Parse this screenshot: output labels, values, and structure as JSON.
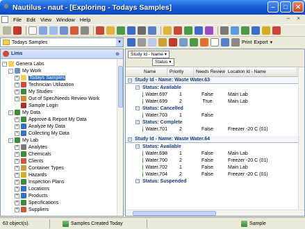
{
  "window": {
    "title": "Nautilus - naut - [Exploring - Todays Samples]"
  },
  "menu": [
    "File",
    "Edit",
    "View",
    "Window",
    "Help"
  ],
  "address": {
    "value": "Todays Samples"
  },
  "left_panel": {
    "title": "Lims",
    "tree": [
      {
        "label": "Genera Labs",
        "icon": "folder-icon",
        "color": "#f3cf5a",
        "depth": 0,
        "expander": "-"
      },
      {
        "label": "My Work",
        "icon": "work-icon",
        "color": "#6a8fc9",
        "depth": 1,
        "expander": "-"
      },
      {
        "label": "Todays Samples",
        "icon": "samples-icon",
        "color": "#f3cf5a",
        "depth": 2,
        "expander": "+",
        "selected": true
      },
      {
        "label": "Technician Utilization",
        "icon": "chart-icon",
        "color": "#d04a3a",
        "depth": 2,
        "expander": "+"
      },
      {
        "label": "My Studies",
        "icon": "study-icon",
        "color": "#3a8c3a",
        "depth": 2,
        "expander": "+"
      },
      {
        "label": "Out of Spec/Needs Review Work",
        "icon": "warning-icon",
        "color": "#d08a2a",
        "depth": 2,
        "expander": "+"
      },
      {
        "label": "Sample Login",
        "icon": "login-icon",
        "color": "#b03030",
        "depth": 2,
        "expander": ""
      },
      {
        "label": "My Data",
        "icon": "data-icon",
        "color": "#3a8c3a",
        "depth": 1,
        "expander": "-"
      },
      {
        "label": "Approve & Report My Data",
        "icon": "approve-icon",
        "color": "#3a8c3a",
        "depth": 2,
        "expander": "+"
      },
      {
        "label": "Analyze My Data",
        "icon": "analyze-icon",
        "color": "#3a6cc9",
        "depth": 2,
        "expander": "+"
      },
      {
        "label": "Collecting My Data",
        "icon": "collect-icon",
        "color": "#3a6cc9",
        "depth": 2,
        "expander": "+"
      },
      {
        "label": "My Lab",
        "icon": "lab-icon",
        "color": "#3a8c3a",
        "depth": 1,
        "expander": "-"
      },
      {
        "label": "Analytes",
        "icon": "analytes-icon",
        "color": "#7a7a7a",
        "depth": 2,
        "expander": "+"
      },
      {
        "label": "Chemicals",
        "icon": "chemicals-icon",
        "color": "#3a8c3a",
        "depth": 2,
        "expander": "+"
      },
      {
        "label": "Clients",
        "icon": "clients-icon",
        "color": "#c95a3a",
        "depth": 2,
        "expander": "+"
      },
      {
        "label": "Container Types",
        "icon": "container-icon",
        "color": "#c9a03a",
        "depth": 2,
        "expander": "+"
      },
      {
        "label": "Hazards",
        "icon": "hazard-icon",
        "color": "#d0b020",
        "depth": 2,
        "expander": "+"
      },
      {
        "label": "Inspection Plans",
        "icon": "inspection-icon",
        "color": "#3a8c3a",
        "depth": 2,
        "expander": "+"
      },
      {
        "label": "Locations",
        "icon": "location-icon",
        "color": "#3a6cc9",
        "depth": 2,
        "expander": "+"
      },
      {
        "label": "Products",
        "icon": "products-icon",
        "color": "#3a6cc9",
        "depth": 2,
        "expander": "+"
      },
      {
        "label": "Specifications",
        "icon": "spec-icon",
        "color": "#3a8c3a",
        "depth": 2,
        "expander": "+"
      },
      {
        "label": "Suppliers",
        "icon": "suppliers-icon",
        "color": "#c95a3a",
        "depth": 2,
        "expander": "+"
      }
    ]
  },
  "right_panel": {
    "toolbar": {
      "print_label": "Print",
      "export_label": "Export"
    },
    "group_chips": {
      "study": "Study Id - Name",
      "status": "Status"
    },
    "columns": [
      "Name",
      "Priority",
      "Needs Review",
      "Location Id - Name"
    ],
    "groups": [
      {
        "label": "Study Id - Name: Waste Water.63",
        "statuses": [
          {
            "label": "Status: Available",
            "rows": [
              {
                "name": "Water.697",
                "priority": "1",
                "needs_review": "False",
                "location": "Main Lab"
              },
              {
                "name": "Water.699",
                "priority": "2",
                "needs_review": "True",
                "location": "Main Lab"
              }
            ]
          },
          {
            "label": "Status: Cancelled",
            "rows": [
              {
                "name": "Water.703",
                "priority": "1",
                "needs_review": "False",
                "location": ""
              }
            ]
          },
          {
            "label": "Status: Complete",
            "rows": [
              {
                "name": "Water.701",
                "priority": "2",
                "needs_review": "False",
                "location": "Freezer -20 C (01)"
              }
            ]
          }
        ]
      },
      {
        "label": "Study Id - Name: Waste Water.64",
        "statuses": [
          {
            "label": "Status: Available",
            "rows": [
              {
                "name": "Water.698",
                "priority": "1",
                "needs_review": "False",
                "location": "Main Lab"
              },
              {
                "name": "Water.700",
                "priority": "2",
                "needs_review": "False",
                "location": "Freezer -20 C (01)"
              },
              {
                "name": "Water.702",
                "priority": "1",
                "needs_review": "False",
                "location": "Main Lab"
              },
              {
                "name": "Water.704",
                "priority": "2",
                "needs_review": "False",
                "location": "Freezer -20 C (01)"
              }
            ]
          },
          {
            "label": "Status: Suspended",
            "rows": []
          }
        ]
      }
    ]
  },
  "status_bar": {
    "count": "63 object(s).",
    "view_name": "Samples Created Today",
    "entity": "Sample"
  }
}
